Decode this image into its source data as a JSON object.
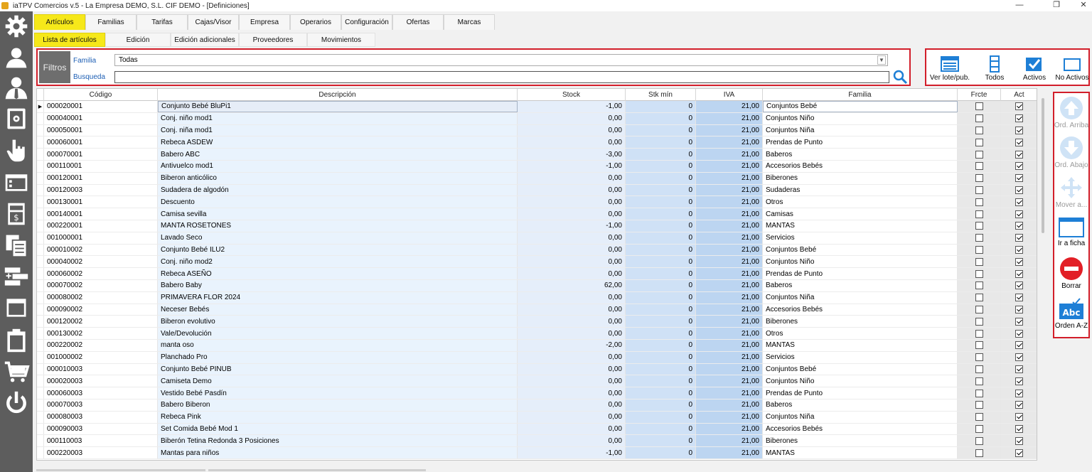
{
  "window": {
    "title": "iaTPV Comercios v.5 - La Empresa DEMO, S.L. CIF DEMO - [Definiciones]",
    "min": "—",
    "max": "❐",
    "close": "✕"
  },
  "colors": {
    "accent": "#f6e81a",
    "highlight_border": "#d21e2a",
    "sidebar": "#5d5d5d",
    "icon_blue": "#1e7fd6"
  },
  "sidebar": [
    "gear-icon",
    "user-icon",
    "user-admin-icon",
    "safe-icon",
    "hand-pointer-icon",
    "terminal-window-icon",
    "cash-register-icon",
    "copy-documents-icon",
    "add-list-icon",
    "window-icon",
    "clipboard-icon",
    "shopping-cart-icon",
    "power-icon"
  ],
  "tabs": [
    "Artículos",
    "Familias",
    "Tarifas",
    "Cajas/Visor",
    "Empresa",
    "Operarios",
    "Configuración",
    "Ofertas",
    "Marcas"
  ],
  "subtabs": [
    "Lista de artículos",
    "Edición",
    "Edición adicionales",
    "Proveedores",
    "Movimientos"
  ],
  "filters": {
    "label": "Filtros",
    "familia_label": "Familia",
    "familia_value": "Todas",
    "busqueda_label": "Busqueda",
    "busqueda_value": ""
  },
  "view_buttons": [
    "Ver lote/pub.",
    "Todos",
    "Activos",
    "No Activos"
  ],
  "columns": [
    "Código",
    "Descripción",
    "Stock",
    "Stk mín",
    "IVA",
    "Familia",
    "Frcte",
    "Act"
  ],
  "rows": [
    {
      "codigo": "000020001",
      "descripcion": "Conjunto Bebé BluPi1",
      "stock": "-1,00",
      "stk_min": "0",
      "iva": "21,00",
      "familia": "Conjuntos Bebé",
      "frecuente": false,
      "activo": true
    },
    {
      "codigo": "000040001",
      "descripcion": "Conj. niño mod1",
      "stock": "0,00",
      "stk_min": "0",
      "iva": "21,00",
      "familia": "Conjuntos Niño",
      "frecuente": false,
      "activo": true
    },
    {
      "codigo": "000050001",
      "descripcion": "Conj. niña mod1",
      "stock": "0,00",
      "stk_min": "0",
      "iva": "21,00",
      "familia": "Conjuntos Niña",
      "frecuente": false,
      "activo": true
    },
    {
      "codigo": "000060001",
      "descripcion": "Rebeca ASDEW",
      "stock": "0,00",
      "stk_min": "0",
      "iva": "21,00",
      "familia": "Prendas de Punto",
      "frecuente": false,
      "activo": true
    },
    {
      "codigo": "000070001",
      "descripcion": "Babero ABC",
      "stock": "-3,00",
      "stk_min": "0",
      "iva": "21,00",
      "familia": "Baberos",
      "frecuente": false,
      "activo": true
    },
    {
      "codigo": "000110001",
      "descripcion": "Antivuelco mod1",
      "stock": "-1,00",
      "stk_min": "0",
      "iva": "21,00",
      "familia": "Accesorios Bebés",
      "frecuente": false,
      "activo": true
    },
    {
      "codigo": "000120001",
      "descripcion": "Biberon anticólico",
      "stock": "0,00",
      "stk_min": "0",
      "iva": "21,00",
      "familia": "Biberones",
      "frecuente": false,
      "activo": true
    },
    {
      "codigo": "000120003",
      "descripcion": "Sudadera de algodón",
      "stock": "0,00",
      "stk_min": "0",
      "iva": "21,00",
      "familia": "Sudaderas",
      "frecuente": false,
      "activo": true
    },
    {
      "codigo": "000130001",
      "descripcion": "Descuento",
      "stock": "0,00",
      "stk_min": "0",
      "iva": "21,00",
      "familia": "Otros",
      "frecuente": false,
      "activo": true
    },
    {
      "codigo": "000140001",
      "descripcion": "Camisa sevilla",
      "stock": "0,00",
      "stk_min": "0",
      "iva": "21,00",
      "familia": "Camisas",
      "frecuente": false,
      "activo": true
    },
    {
      "codigo": "000220001",
      "descripcion": "MANTA ROSETONES",
      "stock": "-1,00",
      "stk_min": "0",
      "iva": "21,00",
      "familia": "MANTAS",
      "frecuente": false,
      "activo": true
    },
    {
      "codigo": "001000001",
      "descripcion": "Lavado Seco",
      "stock": "0,00",
      "stk_min": "0",
      "iva": "21,00",
      "familia": "Servicios",
      "frecuente": false,
      "activo": true
    },
    {
      "codigo": "000010002",
      "descripcion": "Conjunto Bebé ILU2",
      "stock": "0,00",
      "stk_min": "0",
      "iva": "21,00",
      "familia": "Conjuntos Bebé",
      "frecuente": false,
      "activo": true
    },
    {
      "codigo": "000040002",
      "descripcion": "Conj. niño mod2",
      "stock": "0,00",
      "stk_min": "0",
      "iva": "21,00",
      "familia": "Conjuntos Niño",
      "frecuente": false,
      "activo": true
    },
    {
      "codigo": "000060002",
      "descripcion": "Rebeca ASEÑO",
      "stock": "0,00",
      "stk_min": "0",
      "iva": "21,00",
      "familia": "Prendas de Punto",
      "frecuente": false,
      "activo": true
    },
    {
      "codigo": "000070002",
      "descripcion": "Babero Baby",
      "stock": "62,00",
      "stk_min": "0",
      "iva": "21,00",
      "familia": "Baberos",
      "frecuente": false,
      "activo": true
    },
    {
      "codigo": "000080002",
      "descripcion": "PRIMAVERA FLOR 2024",
      "stock": "0,00",
      "stk_min": "0",
      "iva": "21,00",
      "familia": "Conjuntos Niña",
      "frecuente": false,
      "activo": true
    },
    {
      "codigo": "000090002",
      "descripcion": "Neceser Bebés",
      "stock": "0,00",
      "stk_min": "0",
      "iva": "21,00",
      "familia": "Accesorios Bebés",
      "frecuente": false,
      "activo": true
    },
    {
      "codigo": "000120002",
      "descripcion": "Biberon evolutivo",
      "stock": "0,00",
      "stk_min": "0",
      "iva": "21,00",
      "familia": "Biberones",
      "frecuente": false,
      "activo": true
    },
    {
      "codigo": "000130002",
      "descripcion": "Vale/Devolución",
      "stock": "0,00",
      "stk_min": "0",
      "iva": "21,00",
      "familia": "Otros",
      "frecuente": false,
      "activo": true
    },
    {
      "codigo": "000220002",
      "descripcion": "manta oso",
      "stock": "-2,00",
      "stk_min": "0",
      "iva": "21,00",
      "familia": "MANTAS",
      "frecuente": false,
      "activo": true
    },
    {
      "codigo": "001000002",
      "descripcion": "Planchado Pro",
      "stock": "0,00",
      "stk_min": "0",
      "iva": "21,00",
      "familia": "Servicios",
      "frecuente": false,
      "activo": true
    },
    {
      "codigo": "000010003",
      "descripcion": "Conjunto Bebé PINUB",
      "stock": "0,00",
      "stk_min": "0",
      "iva": "21,00",
      "familia": "Conjuntos Bebé",
      "frecuente": false,
      "activo": true
    },
    {
      "codigo": "000020003",
      "descripcion": "Camiseta Demo",
      "stock": "0,00",
      "stk_min": "0",
      "iva": "21,00",
      "familia": "Conjuntos Niño",
      "frecuente": false,
      "activo": true
    },
    {
      "codigo": "000060003",
      "descripcion": "Vestido Bebé Pasdín",
      "stock": "0,00",
      "stk_min": "0",
      "iva": "21,00",
      "familia": "Prendas de Punto",
      "frecuente": false,
      "activo": true
    },
    {
      "codigo": "000070003",
      "descripcion": "Babero Biberon",
      "stock": "0,00",
      "stk_min": "0",
      "iva": "21,00",
      "familia": "Baberos",
      "frecuente": false,
      "activo": true
    },
    {
      "codigo": "000080003",
      "descripcion": "Rebeca Pink",
      "stock": "0,00",
      "stk_min": "0",
      "iva": "21,00",
      "familia": "Conjuntos Niña",
      "frecuente": false,
      "activo": true
    },
    {
      "codigo": "000090003",
      "descripcion": "Set Comida Bebé Mod 1",
      "stock": "0,00",
      "stk_min": "0",
      "iva": "21,00",
      "familia": "Accesorios Bebés",
      "frecuente": false,
      "activo": true
    },
    {
      "codigo": "000110003",
      "descripcion": "Biberón Tetina Redonda 3 Posiciones",
      "stock": "0,00",
      "stk_min": "0",
      "iva": "21,00",
      "familia": "Biberones",
      "frecuente": false,
      "activo": true
    },
    {
      "codigo": "000220003",
      "descripcion": "Mantas para niños",
      "stock": "-1,00",
      "stk_min": "0",
      "iva": "21,00",
      "familia": "MANTAS",
      "frecuente": false,
      "activo": true
    }
  ],
  "actions": [
    {
      "label": "Ord. Arriba",
      "enabled": false,
      "icon": "arrow-up-icon"
    },
    {
      "label": "Ord. Abajo",
      "enabled": false,
      "icon": "arrow-down-icon"
    },
    {
      "label": "Mover a...",
      "enabled": false,
      "icon": "move-icon"
    },
    {
      "label": "Ir a ficha",
      "enabled": true,
      "icon": "card-icon"
    },
    {
      "label": "Borrar",
      "enabled": true,
      "icon": "delete-icon"
    },
    {
      "label": "Orden A-Z",
      "enabled": true,
      "icon": "sort-az-icon"
    }
  ]
}
